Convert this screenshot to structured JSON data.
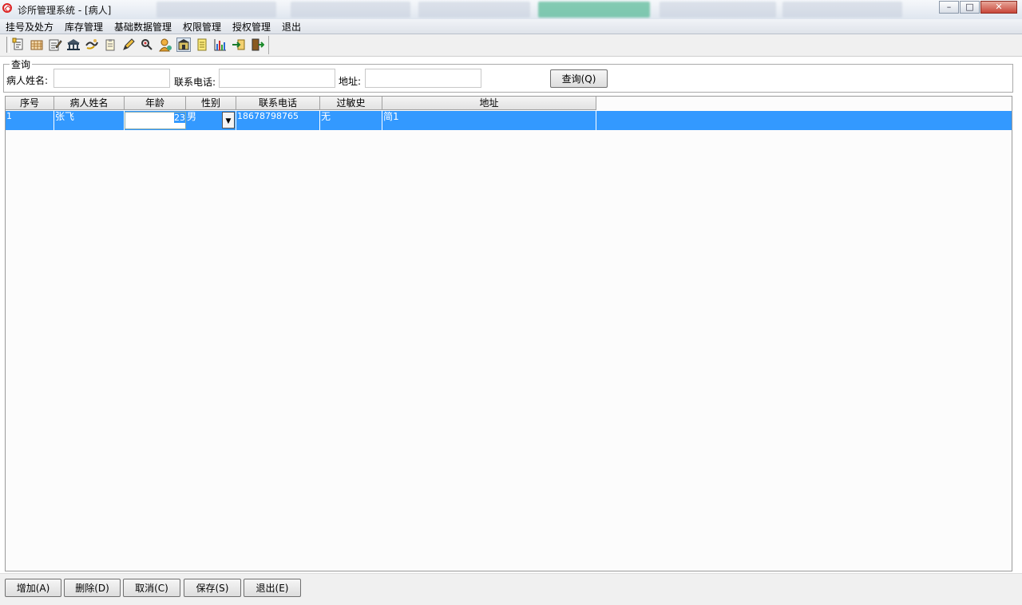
{
  "window": {
    "title": "诊所管理系统 - [病人]"
  },
  "menu": {
    "items": [
      "挂号及处方",
      "库存管理",
      "基础数据管理",
      "权限管理",
      "授权管理",
      "退出"
    ]
  },
  "toolbar": {
    "icons": [
      "registration-icon",
      "calendar-icon",
      "edit-form-icon",
      "bank-icon",
      "handshake-icon",
      "clipboard-icon",
      "pencil-icon",
      "search-person-icon",
      "user-icon",
      "pharmacy-icon",
      "notes-icon",
      "bar-chart-icon",
      "login-icon",
      "exit-door-icon"
    ]
  },
  "query": {
    "legend": "查询",
    "name_label": "病人姓名:",
    "name_value": "",
    "phone_label": "联系电话:",
    "phone_value": "",
    "address_label": "地址:",
    "address_value": "",
    "button": "查询(Q)"
  },
  "grid": {
    "columns": [
      "序号",
      "病人姓名",
      "年龄",
      "性别",
      "联系电话",
      "过敏史",
      "地址"
    ],
    "rows": [
      {
        "no": "1",
        "name": "张飞",
        "age": "23",
        "gender": "男",
        "phone": "18678798765",
        "allergy": "无",
        "address": "简1"
      }
    ]
  },
  "actions": {
    "add": "增加(A)",
    "delete": "删除(D)",
    "cancel": "取消(C)",
    "save": "保存(S)",
    "exit": "退出(E)"
  },
  "colors": {
    "selection": "#3399ff"
  }
}
